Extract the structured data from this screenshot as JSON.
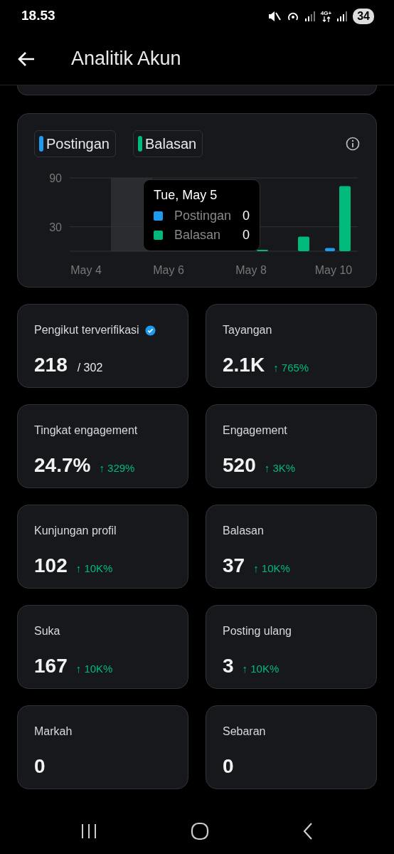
{
  "status_bar": {
    "time": "18.53",
    "network": "4G+",
    "battery": "34"
  },
  "header": {
    "title": "Analitik Akun"
  },
  "chart": {
    "chart_data": {
      "type": "bar",
      "categories": [
        "May 4",
        null,
        "May 6",
        null,
        "May 8",
        null,
        "May 10"
      ],
      "series": [
        {
          "name": "Postingan",
          "color": "#1d9bf0",
          "values": [
            0,
            0,
            0,
            0,
            0,
            0,
            4
          ]
        },
        {
          "name": "Balasan",
          "color": "#00ba7c",
          "values": [
            0,
            0,
            0,
            0,
            1,
            18,
            80
          ]
        }
      ],
      "ylim": [
        0,
        90
      ],
      "yticks": [
        30,
        90
      ]
    },
    "tooltip": {
      "title": "Tue, May 5",
      "rows": [
        {
          "label": "Postingan",
          "value": "0",
          "color": "#1d9bf0"
        },
        {
          "label": "Balasan",
          "value": "0",
          "color": "#00ba7c"
        }
      ]
    }
  },
  "metrics": [
    {
      "label": "Pengikut terverifikasi",
      "verified": true,
      "value": "218",
      "total": "/ 302"
    },
    {
      "label": "Tayangan",
      "value": "2.1K",
      "change": "↑ 765%"
    },
    {
      "label": "Tingkat engagement",
      "value": "24.7%",
      "change": "↑ 329%"
    },
    {
      "label": "Engagement",
      "value": "520",
      "change": "↑ 3K%"
    },
    {
      "label": "Kunjungan profil",
      "value": "102",
      "change": "↑ 10K%"
    },
    {
      "label": "Balasan",
      "value": "37",
      "change": "↑ 10K%"
    },
    {
      "label": "Suka",
      "value": "167",
      "change": "↑ 10K%"
    },
    {
      "label": "Posting ulang",
      "value": "3",
      "change": "↑ 10K%"
    },
    {
      "label": "Markah",
      "value": "0"
    },
    {
      "label": "Sebaran",
      "value": "0"
    }
  ]
}
